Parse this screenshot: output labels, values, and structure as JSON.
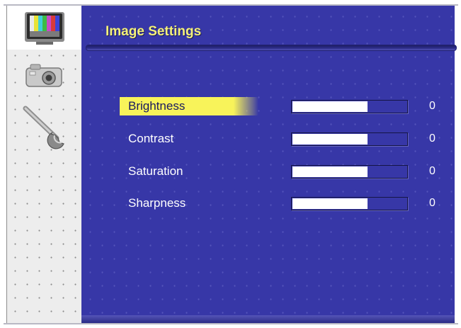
{
  "window": {
    "title": "Image Settings"
  },
  "sidebar": {
    "items": [
      {
        "icon": "color-bars-monitor-icon",
        "active": true
      },
      {
        "icon": "camera-icon",
        "active": false
      },
      {
        "icon": "wrench-icon",
        "active": false
      }
    ]
  },
  "settings": [
    {
      "label": "Brightness",
      "value": "0",
      "level": 0.66,
      "selected": true
    },
    {
      "label": "Contrast",
      "value": "0",
      "level": 0.66,
      "selected": false
    },
    {
      "label": "Saturation",
      "value": "0",
      "level": 0.66,
      "selected": false
    },
    {
      "label": "Sharpness",
      "value": "0",
      "level": 0.66,
      "selected": false
    }
  ],
  "colors": {
    "panel_background": "#3737a7",
    "highlight": "#f8f35a",
    "title_text": "#f4f07a",
    "sidebar_background": "#ededed"
  }
}
